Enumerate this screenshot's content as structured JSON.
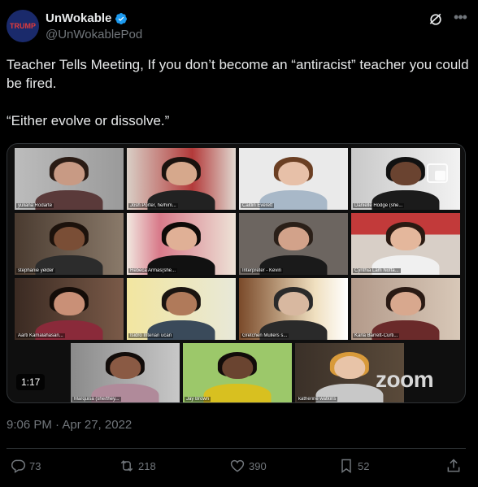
{
  "author": {
    "display_name": "UnWokable",
    "handle": "@UnWokablePod",
    "avatar_text": "TRUMP"
  },
  "tweet": {
    "text": "Teacher Tells Meeting, If you don’t become an “antiracist” teacher you could be fired.\n\n“Either evolve or dissolve.”",
    "timestamp": "9:06 PM · Apr 27, 2022"
  },
  "video": {
    "duration": "1:17",
    "watermark": "zoom",
    "participants": [
      "yuliana Rodarte",
      "Josh Porter, he/him...",
      "Caitlin Everett",
      "Danielle Hodge (she...",
      "stephanie yelder",
      "Rebeca Armas(she...",
      "Interpreter - Kevin",
      "Cynthia Lam Noffa...",
      "Aarti Kamalahasan...",
      "Isidro Interian ucan",
      "Gretchen Mullers s...",
      "Karla Barrett-Curti...",
      "Marquisa (she/they...",
      "Jay Brown",
      "katherine watkins"
    ]
  },
  "actions": {
    "replies": "73",
    "reposts": "218",
    "likes": "390",
    "bookmarks": "52"
  },
  "colors": {
    "background": "#000000",
    "text": "#e7e9ea",
    "muted": "#71767b",
    "verified": "#1d9bf0",
    "active_speaker": "#6fbf3f"
  }
}
